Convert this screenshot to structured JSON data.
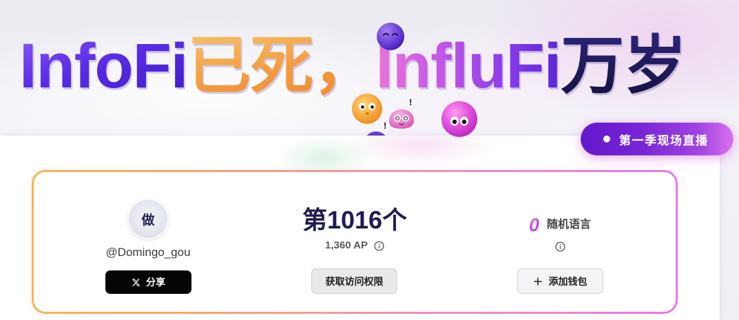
{
  "banner": {
    "title_parts": [
      "InfoFi",
      "已死，",
      "InfluFi",
      "万岁"
    ],
    "exclaim": "!"
  },
  "live_pill": {
    "label": "第一季现场直播",
    "icon": "live-dot-icon"
  },
  "profile": {
    "avatar_text": "做",
    "handle": "@Domingo_gou",
    "share_label": "分享",
    "share_icon": "x-logo-icon"
  },
  "rank": {
    "label": "第1016个",
    "points": "1,360 AP",
    "info_icon": "info-icon",
    "access_label": "获取访问权限"
  },
  "language": {
    "count": "0",
    "label": "随机语言",
    "info_icon": "info-icon",
    "wallet_icon": "plus-icon",
    "wallet_label": "添加钱包"
  },
  "colors": {
    "title_infofi": "#5a2ce6",
    "title_dead": "#f39a3e",
    "title_influfi": "#c457e6",
    "title_long_live": "#1d1852",
    "live_pill": "#7726d6",
    "card_border_start": "#f7b64e",
    "card_border_end": "#e77ae6",
    "share_button": "#050505",
    "rank_text": "#1e1b54"
  }
}
